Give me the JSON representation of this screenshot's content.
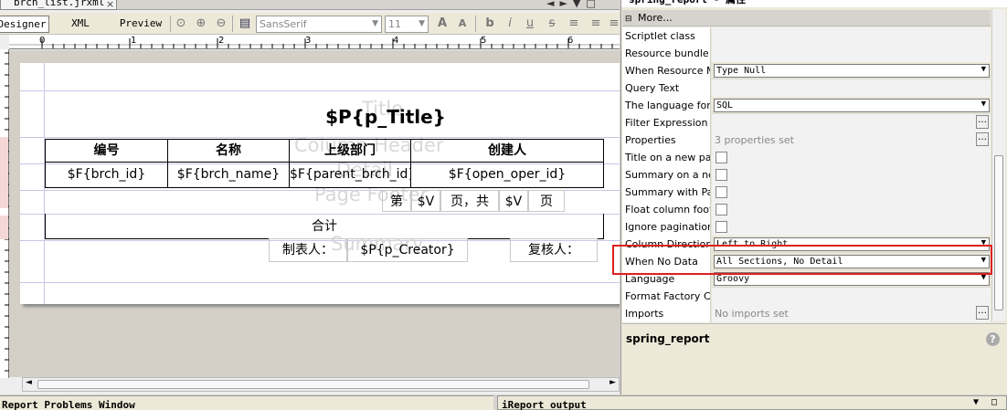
{
  "editor": {
    "file_tab": "brch_list.jrxml",
    "view_tabs": {
      "designer": "Designer",
      "xml": "XML",
      "preview": "Preview"
    },
    "font_value": "SansSerif",
    "size_value": "11",
    "ruler_marks": [
      "0",
      "1",
      "2",
      "3",
      "4",
      "5",
      "6"
    ]
  },
  "report": {
    "band_labels": {
      "title": "Title",
      "column_header": "Column Header",
      "detail": "Detail",
      "page_footer": "Page Footer",
      "summary": "Summary"
    },
    "title_expr": "$P{p_Title}",
    "headers": [
      "编号",
      "名称",
      "上级部门",
      "创建人"
    ],
    "fields": [
      "$F{brch_id}",
      "$F{brch_name}",
      "$F{parent_brch_id}",
      "$F{open_oper_id}"
    ],
    "footer": {
      "di": "第",
      "v1": "$V",
      "page_total": "页，共",
      "v2": "$V",
      "page": "页"
    },
    "summary_total": "合计",
    "creator_label": "制表人：",
    "creator_expr": "$P{p_Creator}",
    "reviewer_label": "复核人："
  },
  "props": {
    "title": "spring_report - 属性",
    "more": "More...",
    "rows": [
      {
        "name": "Scriptlet class",
        "value": ""
      },
      {
        "name": "Resource bundle",
        "value": ""
      },
      {
        "name": "When Resource Missing Type",
        "value": "Type Null"
      },
      {
        "name": "Query Text",
        "value": ""
      },
      {
        "name": "The language for the dataset query",
        "value": "SQL"
      },
      {
        "name": "Filter Expression",
        "value": ""
      },
      {
        "name": "Properties",
        "value": "3 properties set"
      },
      {
        "name": "Title on a new page",
        "value": ""
      },
      {
        "name": "Summary on a new page",
        "value": ""
      },
      {
        "name": "Summary with Page Header and Footer",
        "value": ""
      },
      {
        "name": "Float column footer",
        "value": ""
      },
      {
        "name": "Ignore pagination",
        "value": ""
      },
      {
        "name": "Column Direction",
        "value": "Left to Right"
      },
      {
        "name": "When No Data",
        "value": "All Sections, No Detail"
      },
      {
        "name": "Language",
        "value": "Groovy"
      },
      {
        "name": "Format Factory Class",
        "value": ""
      },
      {
        "name": "Imports",
        "value": "No imports set"
      }
    ],
    "footer_name": "spring_report",
    "help": "?"
  },
  "bottom": {
    "problems": "Report Problems Window",
    "output": "iReport output"
  }
}
